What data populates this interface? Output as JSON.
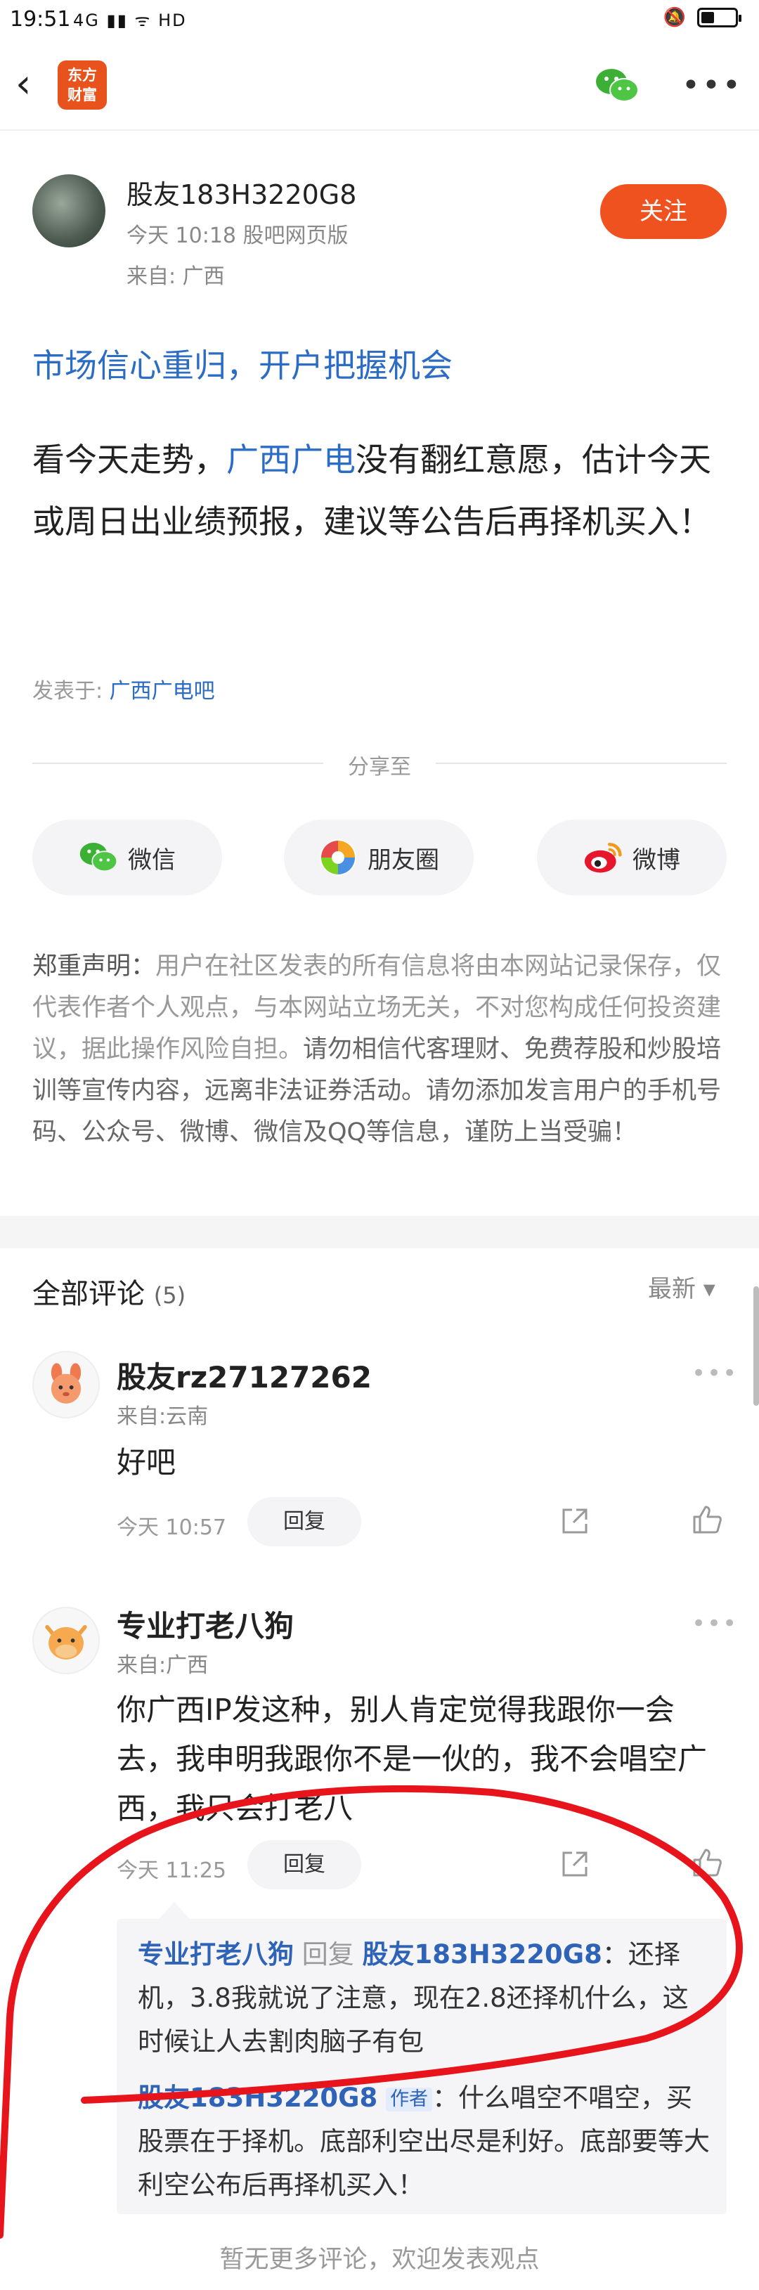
{
  "status_bar": {
    "time": "19:51",
    "signal": "4G ▮▮ ᯤ HD"
  },
  "nav": {
    "logo_line1": "东方",
    "logo_line2": "财富"
  },
  "post": {
    "author": "股友183H3220G8",
    "meta": "今天 10:18 股吧网页版",
    "location": "来自: 广西",
    "follow_label": "关注",
    "title": "市场信心重归，开户把握机会",
    "body_before": "看今天走势，",
    "body_link": "广西广电",
    "body_after": "没有翻红意愿，估计今天或周日出业绩预报，建议等公告后再择机买入！",
    "published_prefix": "发表于: ",
    "published_bar": "广西广电吧"
  },
  "share": {
    "label": "分享至",
    "wechat": "微信",
    "moments": "朋友圈",
    "weibo": "微博"
  },
  "disclaimer": {
    "title": "郑重声明：",
    "text1": "用户在社区发表的所有信息将由本网站记录保存，仅代表作者个人观点，与本网站立场无关，不对您构成任何投资建议，据此操作风险自担。",
    "text2": "请勿相信代客理财、免费荐股和炒股培训等宣传内容，远离非法证券活动。请勿添加发言用户的手机号码、公众号、微博、微信及QQ等信息，谨防上当受骗！"
  },
  "comments": {
    "title": "全部评论",
    "count": "(5)",
    "sort": "最新 ▾",
    "items": [
      {
        "name": "股友rz27127262",
        "location": "来自:云南",
        "text": "好吧",
        "time": "今天 10:57",
        "reply": "回复"
      },
      {
        "name": "专业打老八狗",
        "location": "来自:广西",
        "text": "你广西IP发这种，别人肯定觉得我跟你一会去，我申明我跟你不是一伙的，我不会唱空广西，我只会打老八",
        "time": "今天 11:25",
        "reply": "回复"
      }
    ],
    "replies": [
      {
        "from": "专业打老八狗",
        "action": " 回复 ",
        "to": "股友183H3220G8",
        "text": "：还择机，3.8我就说了注意，现在2.8还择机什么，这时候让人去割肉脑子有包"
      },
      {
        "from": "股友183H3220G8",
        "tag": "作者",
        "text": "：什么唱空不唱空，买股票在于择机。底部利空出尽是利好。底部要等大利空公布后再择机买入！"
      }
    ]
  },
  "footer": "暂无更多评论，欢迎发表观点",
  "colors": {
    "accent": "#f0521f",
    "link": "#2b6cc4",
    "annotation": "#e8141c"
  }
}
